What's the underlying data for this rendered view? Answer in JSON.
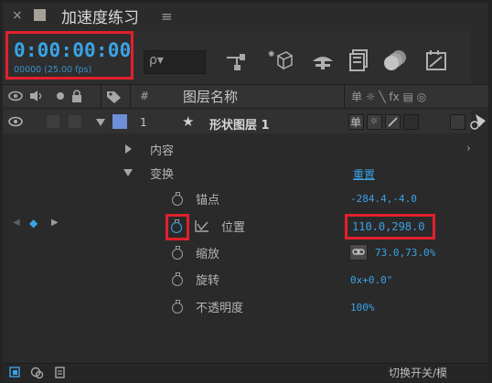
{
  "tab": {
    "close_glyph": "×",
    "title": "加速度练习",
    "menu_glyph": "≡"
  },
  "timecode": {
    "value": "0:00:00:00",
    "frames_fps": "00000 (25.00 fps)"
  },
  "search": {
    "icon_glyph": "ρ▾"
  },
  "header": {
    "hash": "#",
    "layer_name": "图层名称",
    "switch_glyphs": "单 ☼ ╲ fx ▤ ◎"
  },
  "layer": {
    "number": "1",
    "star": "★",
    "name": "形状图层 1",
    "switch_glyph": "单"
  },
  "properties": {
    "contents": "内容",
    "transform": "变换",
    "reset": "重置",
    "anchor_point": {
      "label": "锚点",
      "value": "-284.4,-4.0"
    },
    "position": {
      "label": "位置",
      "value": "110.0,298.0"
    },
    "scale": {
      "label": "缩放",
      "value": "73.0,73.0%"
    },
    "rotation": {
      "label": "旋转",
      "value": "0x+0.0°"
    },
    "opacity": {
      "label": "不透明度",
      "value": "100%"
    }
  },
  "footer": {
    "toggle_label": "切换开关/模"
  },
  "colors": {
    "accent": "#3aa3e6",
    "highlight": "#e2202c",
    "label_swatch": "#6c8fd8",
    "panel": "#2c2c2c"
  }
}
